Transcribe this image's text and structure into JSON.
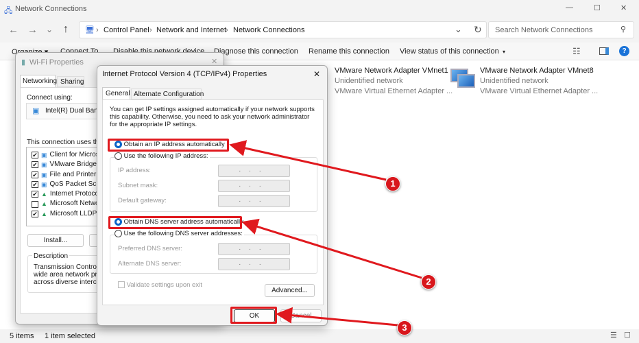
{
  "window": {
    "title": "Network Connections",
    "min": "—",
    "max": "☐",
    "close": "✕"
  },
  "nav": {
    "back": "←",
    "forward": "→",
    "recent": "⌄",
    "up": "↑",
    "breadcrumb": [
      "Control Panel",
      "Network and Internet",
      "Network Connections"
    ],
    "sep": "›",
    "refresh": "↻",
    "search_placeholder": "Search Network Connections"
  },
  "toolbar": {
    "items": [
      "Organize ▾",
      "Connect To",
      "Disable this network device",
      "Diagnose this connection",
      "Rename this connection",
      "View status of this connection"
    ],
    "more": "▾"
  },
  "adapters": [
    {
      "name": "VMware Network Adapter VMnet1",
      "status": "Unidentified network",
      "device": "VMware Virtual Ethernet Adapter ..."
    },
    {
      "name": "VMware Network Adapter VMnet8",
      "status": "Unidentified network",
      "device": "VMware Virtual Ethernet Adapter ..."
    }
  ],
  "statusbar": {
    "count": "5 items",
    "selected": "1 item selected"
  },
  "wifi": {
    "title": "Wi-Fi Properties",
    "tabs": [
      "Networking",
      "Sharing"
    ],
    "connect_using": "Connect using:",
    "adapter": "Intel(R) Dual Band",
    "uses": "This connection uses the",
    "items": [
      {
        "label": "Client for Microso",
        "checked": true
      },
      {
        "label": "VMware Bridge P",
        "checked": true
      },
      {
        "label": "File and Printer S",
        "checked": true
      },
      {
        "label": "QoS Packet Sch",
        "checked": true
      },
      {
        "label": "Internet Protocol",
        "checked": true
      },
      {
        "label": "Microsoft Networ",
        "checked": false
      },
      {
        "label": "Microsoft LLDP P",
        "checked": true
      }
    ],
    "install": "Install...",
    "description_label": "Description",
    "description": [
      "Transmission Control P",
      "wide area network prot",
      "across diverse intercon"
    ],
    "close": "✕"
  },
  "ipv4": {
    "title": "Internet Protocol Version 4 (TCP/IPv4) Properties",
    "close": "✕",
    "tabs": [
      "General",
      "Alternate Configuration"
    ],
    "intro": [
      "You can get IP settings assigned automatically if your network supports",
      "this capability. Otherwise, you need to ask your network administrator",
      "for the appropriate IP settings."
    ],
    "auto_ip": "Obtain an IP address automatically",
    "manual_ip": "Use the following IP address:",
    "ip_fields": [
      "IP address:",
      "Subnet mask:",
      "Default gateway:"
    ],
    "auto_dns": "Obtain DNS server address automatically",
    "manual_dns": "Use the following DNS server addresses:",
    "dns_fields": [
      "Preferred DNS server:",
      "Alternate DNS server:"
    ],
    "field_value": "...",
    "validate": "Validate settings upon exit",
    "advanced": "Advanced...",
    "ok": "OK",
    "cancel": "Cancel"
  },
  "annotations": [
    "1",
    "2",
    "3"
  ],
  "colors": {
    "annotation": "#e0191e",
    "accent": "#0a64c8"
  }
}
